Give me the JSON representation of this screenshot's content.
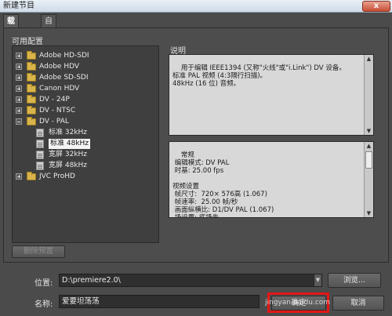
{
  "window": {
    "title": "新建节目",
    "close_glyph": "x"
  },
  "tabs": [
    {
      "label": "载入预置",
      "active": true
    },
    {
      "label": "自定配置",
      "active": false
    }
  ],
  "presets": {
    "label": "可用配置",
    "items": [
      {
        "label": "Adobe HD-SDI",
        "type": "folder",
        "expanded": false
      },
      {
        "label": "Adobe HDV",
        "type": "folder",
        "expanded": false
      },
      {
        "label": "Adobe SD-SDI",
        "type": "folder",
        "expanded": false
      },
      {
        "label": "Canon HDV",
        "type": "folder",
        "expanded": false
      },
      {
        "label": "DV - 24P",
        "type": "folder",
        "expanded": false
      },
      {
        "label": "DV - NTSC",
        "type": "folder",
        "expanded": false
      },
      {
        "label": "DV - PAL",
        "type": "folder",
        "expanded": true
      },
      {
        "label": "标准 32kHz",
        "type": "preset"
      },
      {
        "label": "标准 48kHz",
        "type": "preset",
        "selected": true
      },
      {
        "label": "宽屏 32kHz",
        "type": "preset"
      },
      {
        "label": "宽屏 48kHz",
        "type": "preset"
      },
      {
        "label": "JVC ProHD",
        "type": "folder",
        "expanded": false
      }
    ],
    "delete_label": "删除预置"
  },
  "description": {
    "label": "说明",
    "text": "用于编辑 IEEE1394 (又称\"火线\"或\"i.Link\") DV 设备。\n标准 PAL 视频 (4:3隔行扫描)。\n48kHz (16 位) 音频。"
  },
  "details": {
    "text": "常规\n 编辑模式: DV PAL\n 时基: 25.00 fps\n\n视频设置\n 帧尺寸:  720× 576高 (1.067)\n 帧速率:  25.00 帧/秒\n 画面纵横比: D1/DV PAL (1.067)\n 场设置: 底场先"
  },
  "location": {
    "label": "位置:",
    "value": "D:\\premiere2.0\\",
    "browse_label": "浏览..."
  },
  "name": {
    "label": "名称:",
    "value": "爱要坦荡荡"
  },
  "actions": {
    "ok_label": "确定",
    "cancel_label": "取消"
  },
  "overlay": {
    "highlight_color": "#e41616",
    "watermark": "jingyan.baidu.com"
  }
}
